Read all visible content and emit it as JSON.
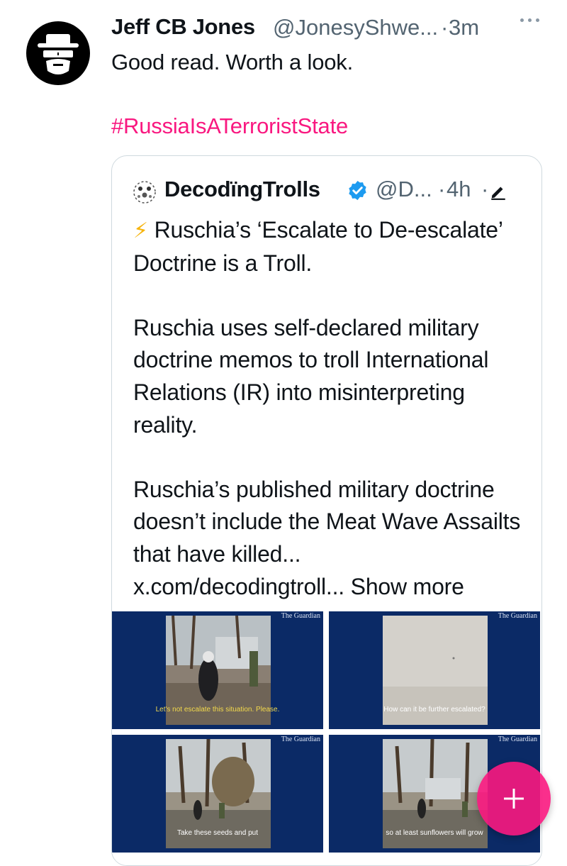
{
  "tweet": {
    "author_name": "Jeff CB Jones",
    "author_handle": "@JonesyShwe...",
    "separator": "·",
    "time": "3m",
    "text": "Good read.  Worth a look.",
    "hashtag": "#RussiaIsATerroristState",
    "avatar_icon": "bearded-man-hat-sunglasses-icon",
    "more_icon": "more-dots-icon"
  },
  "quote": {
    "author_name": "DecodïngTrolls",
    "author_handle": "@D...",
    "separator": "·",
    "time": "4h",
    "verified_color": "#1d9bf0",
    "edit_icon": "edit-pencil-icon",
    "bolt": "⚡",
    "title": "Ruschia’s ‘Escalate to De-escalate’ Doctrine is a Troll.",
    "paragraph_1": "Ruschia uses self-declared military doctrine memos to troll International Relations (IR) into misinterpreting reality.",
    "paragraph_2": "Ruschia’s published military doctrine doesn’t include the Meat Wave Assailts that have killed...",
    "link": "x.com/decodingtroll...",
    "show_more": "Show more"
  },
  "media": [
    {
      "caption": "Let's not escalate this situation. Please.",
      "brand": "The Guardian"
    },
    {
      "caption": "How can it be further escalated?",
      "brand": "The Guardian"
    },
    {
      "caption": "Take these seeds and put",
      "brand": "The Guardian"
    },
    {
      "caption": "so at least sunflowers will grow",
      "brand": "The Guardian"
    }
  ],
  "fab": {
    "icon": "plus-icon",
    "color": "#f91880"
  },
  "colors": {
    "hashtag": "#f91880",
    "secondary_text": "#536471",
    "media_background": "#0b2a66"
  }
}
